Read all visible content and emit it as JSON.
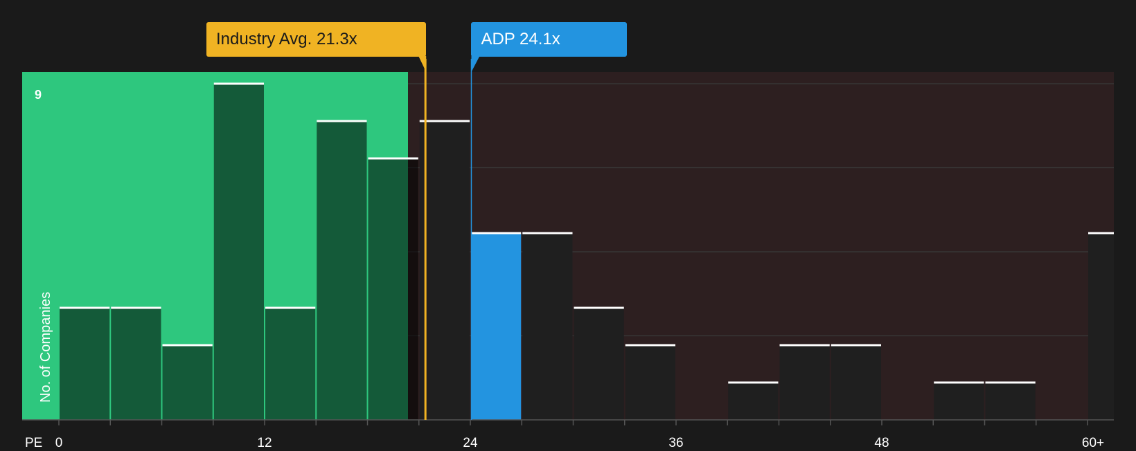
{
  "chart_data": {
    "type": "bar",
    "x_axis_label": "PE",
    "y_axis_label": "No. of Companies",
    "y_max_label": "9",
    "ylim": [
      0,
      9
    ],
    "x_ticks": [
      "0",
      "12",
      "24",
      "36",
      "48",
      "60+"
    ],
    "x_tick_values": [
      0,
      12,
      24,
      36,
      48,
      60
    ],
    "bin_width": 3,
    "bins": [
      {
        "start": 0,
        "count": 3
      },
      {
        "start": 3,
        "count": 3
      },
      {
        "start": 6,
        "count": 2
      },
      {
        "start": 9,
        "count": 9
      },
      {
        "start": 12,
        "count": 3
      },
      {
        "start": 15,
        "count": 8
      },
      {
        "start": 18,
        "count": 7
      },
      {
        "start": 21,
        "count": 8
      },
      {
        "start": 24,
        "count": 5
      },
      {
        "start": 27,
        "count": 5
      },
      {
        "start": 30,
        "count": 3
      },
      {
        "start": 33,
        "count": 2
      },
      {
        "start": 36,
        "count": 0
      },
      {
        "start": 39,
        "count": 1
      },
      {
        "start": 42,
        "count": 2
      },
      {
        "start": 45,
        "count": 2
      },
      {
        "start": 48,
        "count": 0
      },
      {
        "start": 51,
        "count": 1
      },
      {
        "start": 54,
        "count": 1
      },
      {
        "start": 57,
        "count": 0
      },
      {
        "start": 60,
        "count": 5
      }
    ],
    "highlight_bin_start": 24,
    "industry_avg": {
      "label": "Industry Avg. 21.3x",
      "value": 21.3
    },
    "company": {
      "label": "ADP 24.1x",
      "value": 24.1
    },
    "colors": {
      "background": "#1a1a1a",
      "below_avg_zone": "#2ec77e",
      "above_avg_zone": "#2d1f20",
      "industry_avg": "#f0b323",
      "company": "#2394e0",
      "bar_dark": "#1f1f1f",
      "grid": "#3a3a3a"
    }
  }
}
